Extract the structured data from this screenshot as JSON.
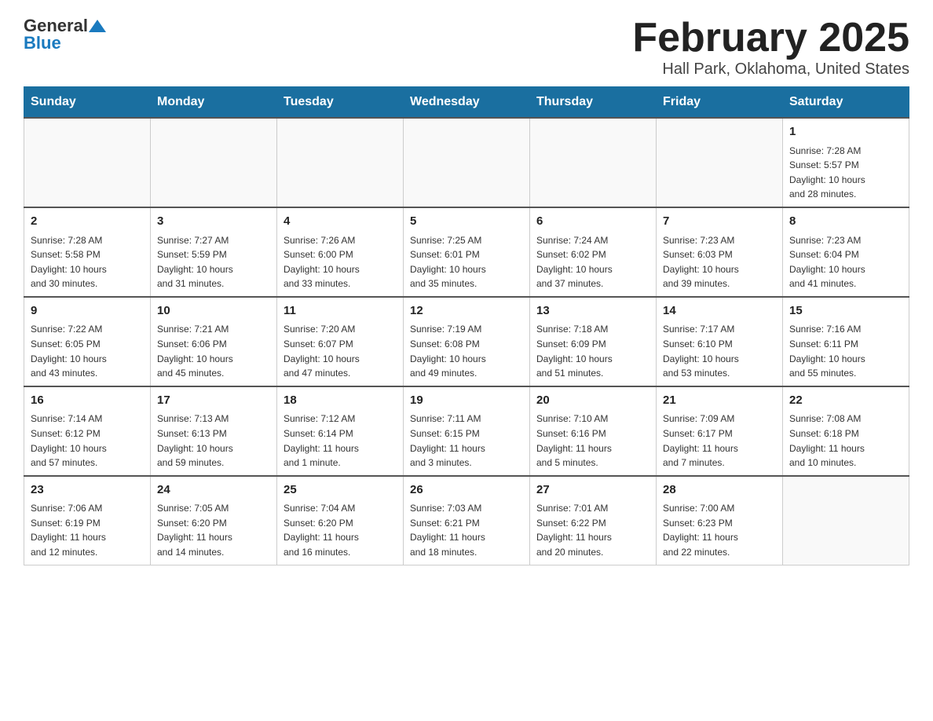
{
  "header": {
    "logo_general": "General",
    "logo_blue": "Blue",
    "title": "February 2025",
    "subtitle": "Hall Park, Oklahoma, United States"
  },
  "calendar": {
    "days_of_week": [
      "Sunday",
      "Monday",
      "Tuesday",
      "Wednesday",
      "Thursday",
      "Friday",
      "Saturday"
    ],
    "weeks": [
      {
        "days": [
          {
            "number": "",
            "info": ""
          },
          {
            "number": "",
            "info": ""
          },
          {
            "number": "",
            "info": ""
          },
          {
            "number": "",
            "info": ""
          },
          {
            "number": "",
            "info": ""
          },
          {
            "number": "",
            "info": ""
          },
          {
            "number": "1",
            "info": "Sunrise: 7:28 AM\nSunset: 5:57 PM\nDaylight: 10 hours\nand 28 minutes."
          }
        ]
      },
      {
        "days": [
          {
            "number": "2",
            "info": "Sunrise: 7:28 AM\nSunset: 5:58 PM\nDaylight: 10 hours\nand 30 minutes."
          },
          {
            "number": "3",
            "info": "Sunrise: 7:27 AM\nSunset: 5:59 PM\nDaylight: 10 hours\nand 31 minutes."
          },
          {
            "number": "4",
            "info": "Sunrise: 7:26 AM\nSunset: 6:00 PM\nDaylight: 10 hours\nand 33 minutes."
          },
          {
            "number": "5",
            "info": "Sunrise: 7:25 AM\nSunset: 6:01 PM\nDaylight: 10 hours\nand 35 minutes."
          },
          {
            "number": "6",
            "info": "Sunrise: 7:24 AM\nSunset: 6:02 PM\nDaylight: 10 hours\nand 37 minutes."
          },
          {
            "number": "7",
            "info": "Sunrise: 7:23 AM\nSunset: 6:03 PM\nDaylight: 10 hours\nand 39 minutes."
          },
          {
            "number": "8",
            "info": "Sunrise: 7:23 AM\nSunset: 6:04 PM\nDaylight: 10 hours\nand 41 minutes."
          }
        ]
      },
      {
        "days": [
          {
            "number": "9",
            "info": "Sunrise: 7:22 AM\nSunset: 6:05 PM\nDaylight: 10 hours\nand 43 minutes."
          },
          {
            "number": "10",
            "info": "Sunrise: 7:21 AM\nSunset: 6:06 PM\nDaylight: 10 hours\nand 45 minutes."
          },
          {
            "number": "11",
            "info": "Sunrise: 7:20 AM\nSunset: 6:07 PM\nDaylight: 10 hours\nand 47 minutes."
          },
          {
            "number": "12",
            "info": "Sunrise: 7:19 AM\nSunset: 6:08 PM\nDaylight: 10 hours\nand 49 minutes."
          },
          {
            "number": "13",
            "info": "Sunrise: 7:18 AM\nSunset: 6:09 PM\nDaylight: 10 hours\nand 51 minutes."
          },
          {
            "number": "14",
            "info": "Sunrise: 7:17 AM\nSunset: 6:10 PM\nDaylight: 10 hours\nand 53 minutes."
          },
          {
            "number": "15",
            "info": "Sunrise: 7:16 AM\nSunset: 6:11 PM\nDaylight: 10 hours\nand 55 minutes."
          }
        ]
      },
      {
        "days": [
          {
            "number": "16",
            "info": "Sunrise: 7:14 AM\nSunset: 6:12 PM\nDaylight: 10 hours\nand 57 minutes."
          },
          {
            "number": "17",
            "info": "Sunrise: 7:13 AM\nSunset: 6:13 PM\nDaylight: 10 hours\nand 59 minutes."
          },
          {
            "number": "18",
            "info": "Sunrise: 7:12 AM\nSunset: 6:14 PM\nDaylight: 11 hours\nand 1 minute."
          },
          {
            "number": "19",
            "info": "Sunrise: 7:11 AM\nSunset: 6:15 PM\nDaylight: 11 hours\nand 3 minutes."
          },
          {
            "number": "20",
            "info": "Sunrise: 7:10 AM\nSunset: 6:16 PM\nDaylight: 11 hours\nand 5 minutes."
          },
          {
            "number": "21",
            "info": "Sunrise: 7:09 AM\nSunset: 6:17 PM\nDaylight: 11 hours\nand 7 minutes."
          },
          {
            "number": "22",
            "info": "Sunrise: 7:08 AM\nSunset: 6:18 PM\nDaylight: 11 hours\nand 10 minutes."
          }
        ]
      },
      {
        "days": [
          {
            "number": "23",
            "info": "Sunrise: 7:06 AM\nSunset: 6:19 PM\nDaylight: 11 hours\nand 12 minutes."
          },
          {
            "number": "24",
            "info": "Sunrise: 7:05 AM\nSunset: 6:20 PM\nDaylight: 11 hours\nand 14 minutes."
          },
          {
            "number": "25",
            "info": "Sunrise: 7:04 AM\nSunset: 6:20 PM\nDaylight: 11 hours\nand 16 minutes."
          },
          {
            "number": "26",
            "info": "Sunrise: 7:03 AM\nSunset: 6:21 PM\nDaylight: 11 hours\nand 18 minutes."
          },
          {
            "number": "27",
            "info": "Sunrise: 7:01 AM\nSunset: 6:22 PM\nDaylight: 11 hours\nand 20 minutes."
          },
          {
            "number": "28",
            "info": "Sunrise: 7:00 AM\nSunset: 6:23 PM\nDaylight: 11 hours\nand 22 minutes."
          },
          {
            "number": "",
            "info": ""
          }
        ]
      }
    ]
  }
}
